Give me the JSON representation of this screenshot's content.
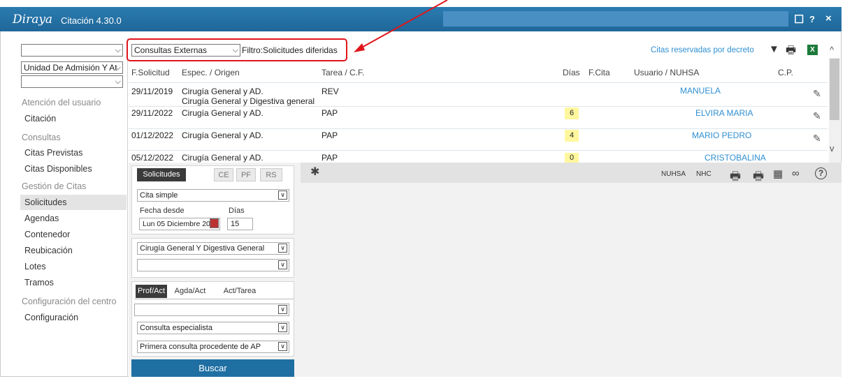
{
  "titlebar": {
    "logo": "Diraya",
    "title": "Citación 4.30.0"
  },
  "sidebar": {
    "select1": "",
    "select2": "Unidad De Admisión Y At",
    "select3": "",
    "sections": [
      {
        "title": "Atención del usuario",
        "items": [
          "Citación"
        ]
      },
      {
        "title": "Consultas",
        "items": [
          "Citas Previstas",
          "Citas Disponibles"
        ]
      },
      {
        "title": "Gestión de Citas",
        "items": [
          "Solicitudes",
          "Agendas",
          "Contenedor",
          "Reubicación",
          "Lotes",
          "Tramos"
        ]
      },
      {
        "title": "Configuración del centro",
        "items": [
          "Configuración"
        ]
      }
    ]
  },
  "filterbar": {
    "consultas_select": "Consultas Externas",
    "filtro_label": "Filtro:Solicitudes diferidas",
    "reservadas_link": "Citas reservadas por decreto"
  },
  "table": {
    "headers": [
      "F.Solicitud",
      "Espec. / Origen",
      "Tarea / C.F.",
      "Días",
      "F.Cita",
      "Usuario / NUHSA",
      "C.P."
    ],
    "rows": [
      {
        "fecha": "29/11/2019",
        "espec": "Cirugía General y AD.",
        "origen": "Cirugía General y Digestiva general",
        "tarea": "REV",
        "dias": "",
        "usuario": "MANUELA"
      },
      {
        "fecha": "29/11/2022",
        "espec": "Cirugía General y AD.",
        "origen": "",
        "tarea": "PAP",
        "dias": "6",
        "usuario": "ELVIRA MARIA"
      },
      {
        "fecha": "01/12/2022",
        "espec": "Cirugía General y AD.",
        "origen": "",
        "tarea": "PAP",
        "dias": "4",
        "usuario": "MARIO PEDRO"
      },
      {
        "fecha": "05/12/2022",
        "espec": "Cirugía General y AD.",
        "origen": "",
        "tarea": "PAP",
        "dias": "0",
        "usuario": "CRISTOBALINA"
      }
    ]
  },
  "bottombar": {
    "nuhsa": "NUHSA",
    "nhc": "NHC"
  },
  "form": {
    "tabs": [
      "Solicitudes",
      "CE",
      "PF",
      "RS"
    ],
    "tipo_cita": "Cita simple",
    "fecha_label": "Fecha desde",
    "dias_label": "Días",
    "fecha_value": "Lun 05 Diciembre 20",
    "dias_value": "15",
    "especialidad": "Cirugía General Y Digestiva General",
    "especialidad2": "",
    "subtabs": [
      "Prof/Act",
      "Agda/Act",
      "Act/Tarea"
    ],
    "prof_select": "",
    "consulta_select": "Consulta especialista",
    "primera_select": "Primera consulta procedente de AP",
    "buscar": "Buscar"
  },
  "colors": {
    "titlebar": "#1f6799",
    "link": "#2f8fd1",
    "highlight": "#fff79e",
    "annotation": "#e0151b"
  }
}
